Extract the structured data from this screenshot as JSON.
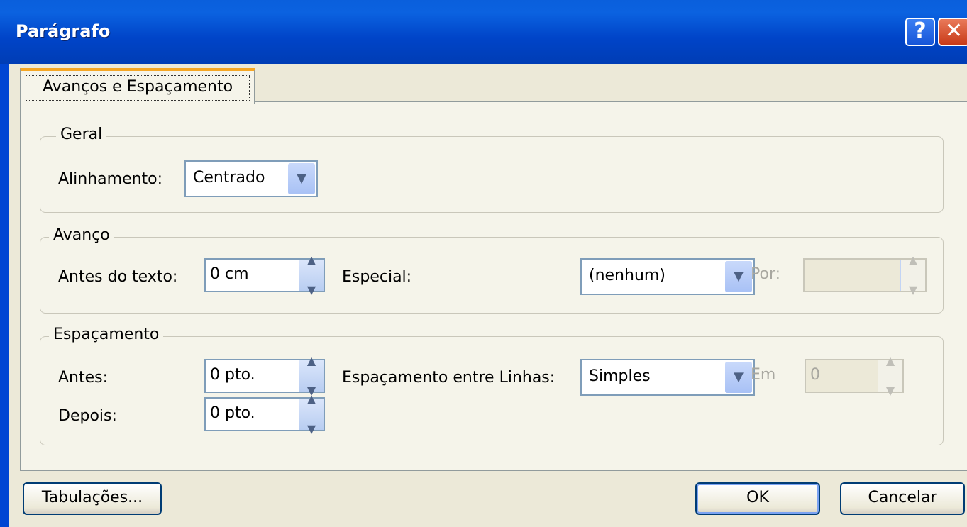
{
  "window": {
    "title": "Parágrafo",
    "help_label": "?",
    "close_label": "✕"
  },
  "tabs": [
    {
      "label": "Avanços e Espaçamento"
    }
  ],
  "geral": {
    "legend": "Geral",
    "alinhamento_label": "Alinhamento:",
    "alinhamento_value": "Centrado"
  },
  "avanco": {
    "legend": "Avanço",
    "antes_texto_label": "Antes do texto:",
    "antes_texto_value": "0 cm",
    "especial_label": "Especial:",
    "especial_value": "(nenhum)",
    "por_label": "Por:",
    "por_value": ""
  },
  "espacamento": {
    "legend": "Espaçamento",
    "antes_label": "Antes:",
    "antes_value": "0 pto.",
    "depois_label": "Depois:",
    "depois_value": "0 pto.",
    "entre_linhas_label": "Espaçamento entre Linhas:",
    "entre_linhas_value": "Simples",
    "em_label": "Em",
    "em_value": "0"
  },
  "buttons": {
    "tabulacoes": "Tabulações...",
    "ok": "OK",
    "cancelar": "Cancelar"
  },
  "icons": {
    "spin": "spin-updown-icon",
    "dropdown": "chevron-down-icon",
    "help": "help-icon",
    "close": "close-icon"
  }
}
